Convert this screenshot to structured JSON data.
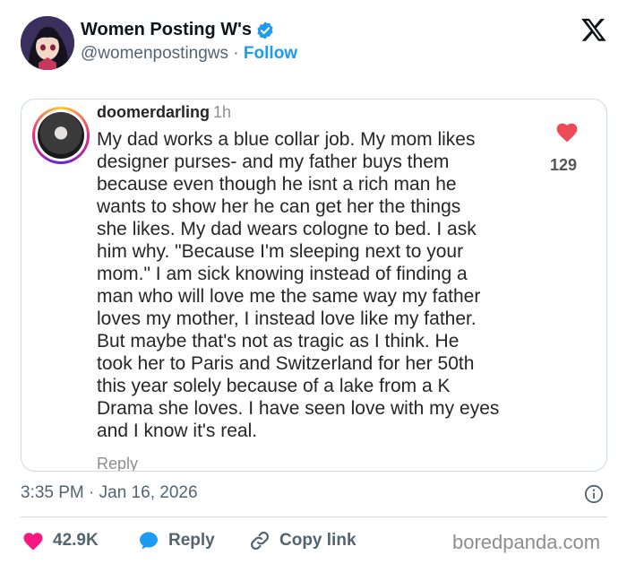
{
  "header": {
    "display_name": "Women Posting W's",
    "handle": "@womenpostingws",
    "separator": " · ",
    "follow_label": "Follow",
    "verified_icon": "verified-badge-icon",
    "logo_icon": "x-logo-icon"
  },
  "comment": {
    "username": "doomerdarling",
    "time_ago": "1h",
    "text_lines": [
      "My dad works a blue collar job. My mom likes",
      "designer purses- and my father buys them",
      "because even though he isnt a rich man he",
      "wants to show her he can get her the things",
      "she likes. My dad wears cologne to bed. I ask",
      "him why. \"Because I'm sleeping next to your",
      "mom.\" I am sick knowing instead of finding a",
      "man who will love me the same way my father",
      "loves my mother, I instead love like my father.",
      "But maybe that's not as tragic as I think. He",
      "took her to Paris and Switzerland for her 50th",
      "this year solely because of a lake from a K",
      "Drama she loves. I have seen love with my eyes",
      "and I know it's real."
    ],
    "reply_label": "Reply",
    "like_count": "129",
    "heart_color": "#ed4956"
  },
  "meta": {
    "timestamp": "3:35 PM · Jan 16, 2026"
  },
  "actions": {
    "like_count": "42.9K",
    "reply_label": "Reply",
    "copy_link_label": "Copy link",
    "like_color": "#f91880",
    "reply_color": "#1d9bf0"
  },
  "watermark": "boredpanda.com",
  "colors": {
    "accent": "#1d9bf0",
    "text_secondary": "#536471",
    "border": "#cfd9de"
  }
}
